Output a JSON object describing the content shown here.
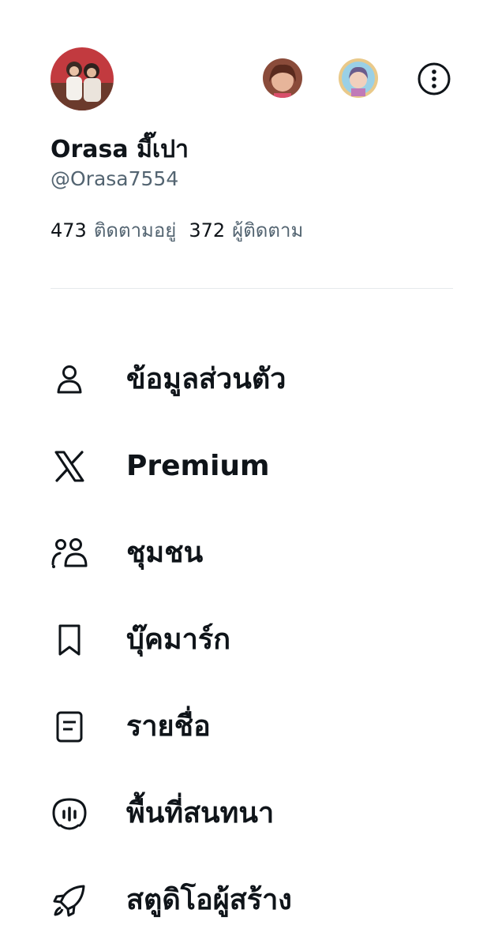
{
  "profile": {
    "display_name": "Orasa มี๊เปา",
    "handle": "@Orasa7554",
    "following_count": "473",
    "following_label": "ติดตามอยู่",
    "followers_count": "372",
    "followers_label": "ผู้ติดตาม"
  },
  "accounts": [
    {
      "icon": "account-avatar-1"
    },
    {
      "icon": "account-avatar-2"
    }
  ],
  "menu": [
    {
      "label": "ข้อมูลส่วนตัว",
      "icon": "profile-icon"
    },
    {
      "label": "Premium",
      "icon": "x-logo-icon"
    },
    {
      "label": "ชุมชน",
      "icon": "communities-icon"
    },
    {
      "label": "บุ๊คมาร์ก",
      "icon": "bookmark-icon"
    },
    {
      "label": "รายชื่อ",
      "icon": "lists-icon"
    },
    {
      "label": "พื้นที่สนทนา",
      "icon": "spaces-icon"
    },
    {
      "label": "สตูดิโอผู้สร้าง",
      "icon": "rocket-icon"
    }
  ],
  "colors": {
    "text": "#0f1419",
    "secondary": "#536471",
    "divider": "#e6e9ec"
  }
}
